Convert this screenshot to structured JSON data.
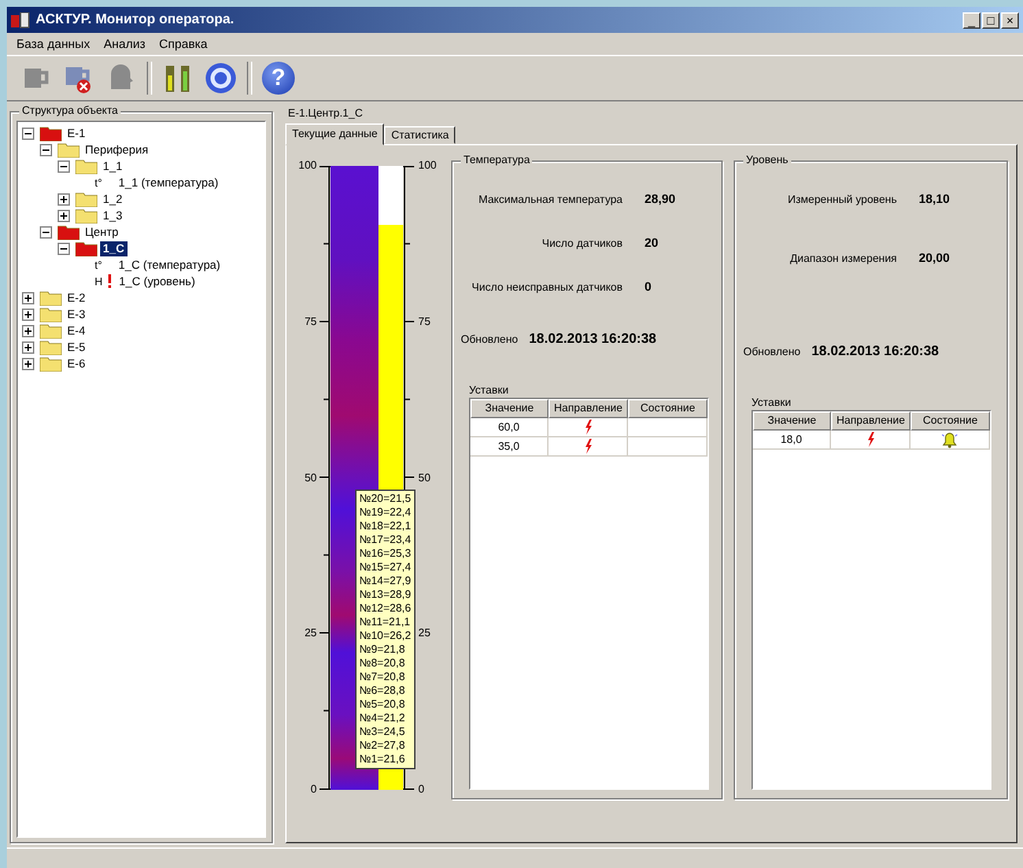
{
  "window": {
    "title": "АСКТУР. Монитор оператора.",
    "controls": [
      "_",
      "□",
      "×"
    ]
  },
  "menu": [
    "База данных",
    "Анализ",
    "Справка"
  ],
  "toolbar": {
    "help_glyph": "?"
  },
  "tree_panel": {
    "title": "Структура объекта",
    "items": [
      {
        "kind": "folder",
        "label": "E-1",
        "alarm": true,
        "expanded": true,
        "selected": false,
        "children": [
          {
            "kind": "folder",
            "label": "Периферия",
            "alarm": false,
            "expanded": true,
            "selected": false,
            "children": [
              {
                "kind": "folder",
                "label": "1_1",
                "alarm": false,
                "expanded": true,
                "selected": false,
                "children": [
                  {
                    "kind": "sensor",
                    "prefix": "t°",
                    "label": "1_1 (температура)",
                    "alarm": false,
                    "selected": false
                  }
                ]
              },
              {
                "kind": "folder",
                "label": "1_2",
                "alarm": false,
                "expanded": false,
                "selected": false
              },
              {
                "kind": "folder",
                "label": "1_3",
                "alarm": false,
                "expanded": false,
                "selected": false
              }
            ]
          },
          {
            "kind": "folder",
            "label": "Центр",
            "alarm": true,
            "expanded": true,
            "selected": false,
            "children": [
              {
                "kind": "folder",
                "label": "1_C",
                "alarm": true,
                "expanded": true,
                "selected": true,
                "children": [
                  {
                    "kind": "sensor",
                    "prefix": "t°",
                    "label": "1_C (температура)",
                    "alarm": false,
                    "selected": false
                  },
                  {
                    "kind": "sensor",
                    "prefix": "H",
                    "label": "1_C (уровень)",
                    "alarm": true,
                    "selected": false
                  }
                ]
              }
            ]
          }
        ]
      },
      {
        "kind": "folder",
        "label": "E-2",
        "alarm": false,
        "expanded": false,
        "selected": false
      },
      {
        "kind": "folder",
        "label": "E-3",
        "alarm": false,
        "expanded": false,
        "selected": false
      },
      {
        "kind": "folder",
        "label": "E-4",
        "alarm": false,
        "expanded": false,
        "selected": false
      },
      {
        "kind": "folder",
        "label": "E-5",
        "alarm": false,
        "expanded": false,
        "selected": false
      },
      {
        "kind": "folder",
        "label": "E-6",
        "alarm": false,
        "expanded": false,
        "selected": false
      }
    ]
  },
  "object_path": "E-1.Центр.1_C",
  "tabs": [
    {
      "label": "Текущие данные",
      "selected": true
    },
    {
      "label": "Статистика",
      "selected": false
    }
  ],
  "gauge": {
    "left_scale": [
      "100",
      "75",
      "50",
      "25",
      "0"
    ],
    "right_scale": [
      "100",
      "75",
      "50",
      "25",
      "0"
    ],
    "level": 0.905,
    "tooltip": [
      "№20=21,5",
      "№19=22,4",
      "№18=22,1",
      "№17=23,4",
      "№16=25,3",
      "№15=27,4",
      "№14=27,9",
      "№13=28,9",
      "№12=28,6",
      "№11=21,1",
      "№10=26,2",
      "№9=21,8",
      "№8=20,8",
      "№7=20,8",
      "№6=28,8",
      "№5=20,8",
      "№4=21,2",
      "№3=24,5",
      "№2=27,8",
      "№1=21,6"
    ]
  },
  "temperature": {
    "title": "Температура",
    "fields": [
      {
        "label": "Максимальная температура",
        "value": "28,90"
      },
      {
        "label": "Число датчиков",
        "value": "20"
      },
      {
        "label": "Число неисправных датчиков",
        "value": "0"
      }
    ],
    "updated": {
      "label": "Обновлено",
      "value": "18.02.2013 16:20:38"
    },
    "setpoints": {
      "title": "Уставки",
      "columns": [
        "Значение",
        "Направление",
        "Состояние"
      ],
      "rows": [
        {
          "value": "60,0",
          "alarm": false
        },
        {
          "value": "35,0",
          "alarm": false
        }
      ]
    }
  },
  "level": {
    "title": "Уровень",
    "fields": [
      {
        "label": "Измеренный уровень",
        "value": "18,10"
      },
      {
        "label": "Диапазон измерения",
        "value": "20,00"
      }
    ],
    "updated": {
      "label": "Обновлено",
      "value": "18.02.2013 16:20:38"
    },
    "setpoints": {
      "title": "Уставки",
      "columns": [
        "Значение",
        "Направление",
        "Состояние"
      ],
      "rows": [
        {
          "value": "18,0",
          "alarm": true
        }
      ]
    }
  }
}
